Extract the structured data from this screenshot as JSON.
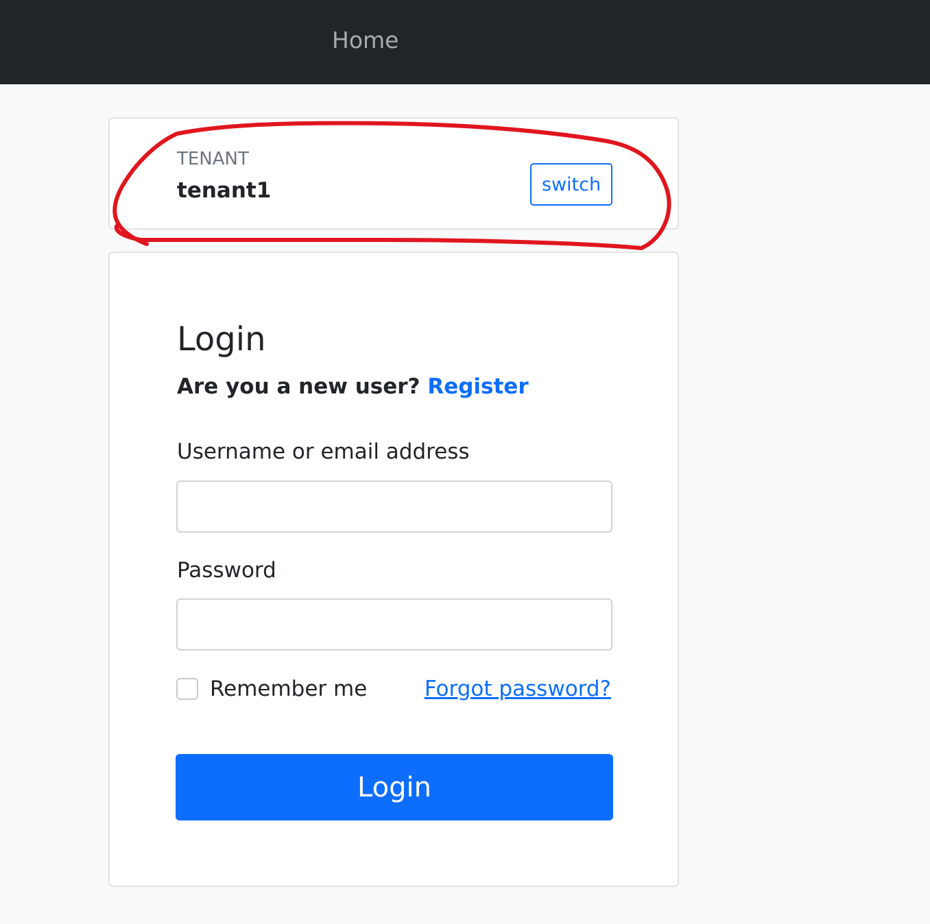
{
  "navbar": {
    "home_label": "Home"
  },
  "tenant": {
    "label": "TENANT",
    "name": "tenant1",
    "switch_label": "switch"
  },
  "login": {
    "title": "Login",
    "new_user_text": "Are you a new user?",
    "register_label": "Register",
    "username_label": "Username or email address",
    "username_value": "",
    "password_label": "Password",
    "password_value": "",
    "remember_label": "Remember me",
    "remember_checked": false,
    "forgot_label": "Forgot password?",
    "submit_label": "Login"
  },
  "colors": {
    "navbar_bg": "#212529",
    "page_bg": "#f8f9fa",
    "primary": "#0d6efd",
    "annotation": "#e0161e"
  }
}
